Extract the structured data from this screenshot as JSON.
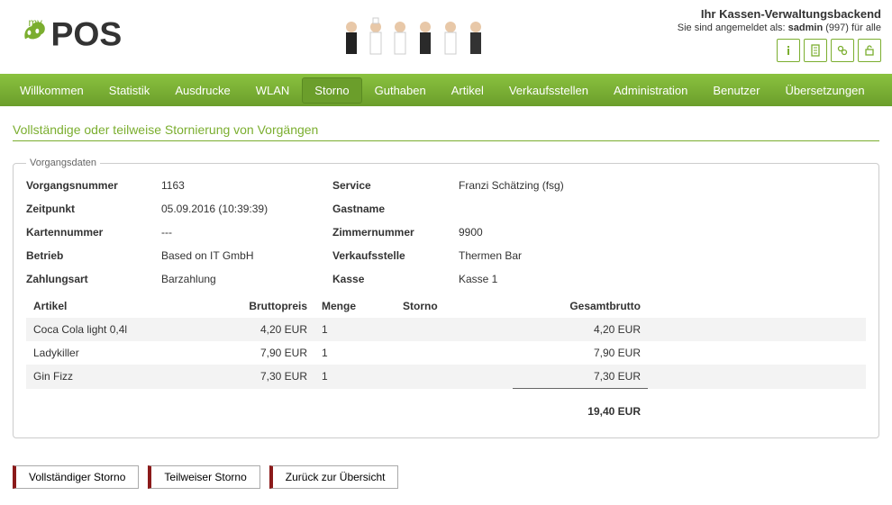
{
  "brand": {
    "prefix": "my",
    "suffix": "POS"
  },
  "header": {
    "title": "Ihr Kassen-Verwaltungsbackend",
    "login_prefix": "Sie sind angemeldet als: ",
    "login_user": "sadmin",
    "login_suffix": " (997) für alle"
  },
  "nav": {
    "items": [
      "Willkommen",
      "Statistik",
      "Ausdrucke",
      "WLAN",
      "Storno",
      "Guthaben",
      "Artikel",
      "Verkaufsstellen",
      "Administration",
      "Benutzer",
      "Übersetzungen"
    ],
    "active_index": 4
  },
  "page": {
    "title": "Vollständige oder teilweise Stornierung von Vorgängen",
    "fieldset_legend": "Vorgangsdaten",
    "labels": {
      "vorgangsnummer": "Vorgangsnummer",
      "zeitpunkt": "Zeitpunkt",
      "kartennummer": "Kartennummer",
      "betrieb": "Betrieb",
      "zahlungsart": "Zahlungsart",
      "service": "Service",
      "gastname": "Gastname",
      "zimmernummer": "Zimmernummer",
      "verkaufsstelle": "Verkaufsstelle",
      "kasse": "Kasse"
    },
    "values": {
      "vorgangsnummer": "1163",
      "zeitpunkt": "05.09.2016 (10:39:39)",
      "kartennummer": "---",
      "betrieb": "Based on IT GmbH",
      "zahlungsart": "Barzahlung",
      "service": "Franzi Schätzing (fsg)",
      "gastname": "",
      "zimmernummer": "9900",
      "verkaufsstelle": "Thermen Bar",
      "kasse": "Kasse 1"
    },
    "columns": {
      "artikel": "Artikel",
      "bruttopreis": "Bruttopreis",
      "menge": "Menge",
      "storno": "Storno",
      "gesamtbrutto": "Gesamtbrutto"
    },
    "rows": [
      {
        "artikel": "Coca Cola light 0,4l",
        "bruttopreis": "4,20 EUR",
        "menge": "1",
        "storno": "",
        "gesamtbrutto": "4,20 EUR"
      },
      {
        "artikel": "Ladykiller",
        "bruttopreis": "7,90 EUR",
        "menge": "1",
        "storno": "",
        "gesamtbrutto": "7,90 EUR"
      },
      {
        "artikel": "Gin Fizz",
        "bruttopreis": "7,30 EUR",
        "menge": "1",
        "storno": "",
        "gesamtbrutto": "7,30 EUR"
      }
    ],
    "total": "19,40 EUR"
  },
  "buttons": {
    "full": "Vollständiger Storno",
    "partial": "Teilweiser Storno",
    "back": "Zurück zur Übersicht"
  }
}
